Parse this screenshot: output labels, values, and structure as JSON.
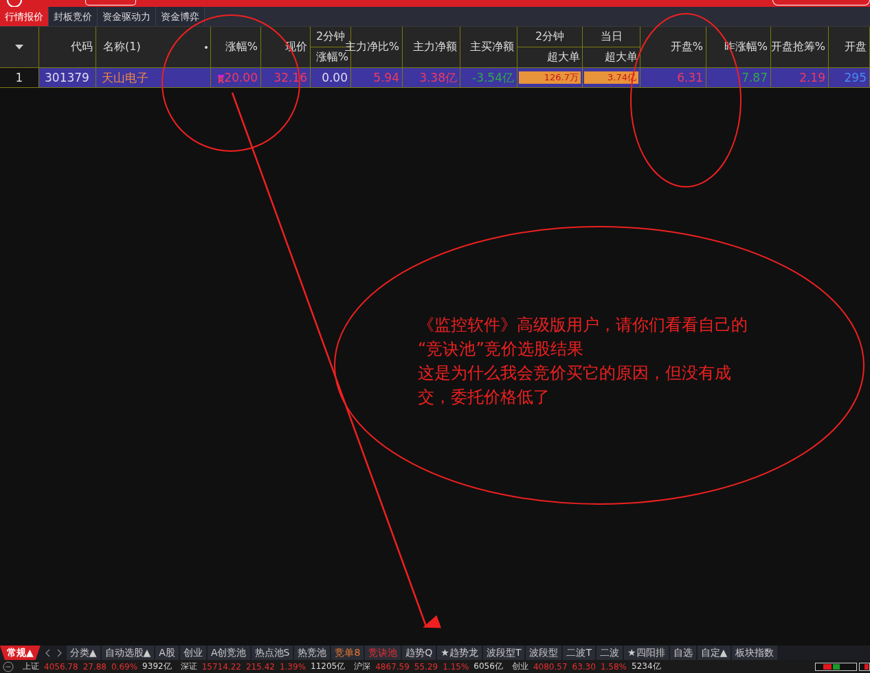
{
  "top_tabs": [
    {
      "label": "行情报价",
      "selected": true
    },
    {
      "label": "封板竞价",
      "selected": false
    },
    {
      "label": "资金驱动力",
      "selected": false
    },
    {
      "label": "资金博弈",
      "selected": false
    }
  ],
  "table": {
    "columns": [
      {
        "label": "代码"
      },
      {
        "label": "名称(1)"
      },
      {
        "label": "涨幅%"
      },
      {
        "label": "现价"
      },
      {
        "group": "2分钟",
        "label": "涨幅%"
      },
      {
        "label": "主力净比%"
      },
      {
        "label": "主力净额"
      },
      {
        "label": "主买净额"
      },
      {
        "group": "2分钟",
        "label": "超大单"
      },
      {
        "group": "当日",
        "label": "超大单"
      },
      {
        "label": "开盘%"
      },
      {
        "label": "昨涨幅%"
      },
      {
        "label": "开盘抢筹%"
      },
      {
        "label": "开盘"
      }
    ],
    "rows": [
      {
        "index": "1",
        "cells": [
          {
            "text": "301379",
            "kind": "plain"
          },
          {
            "text": "天山电子",
            "kind": "name"
          },
          {
            "text": "20.00",
            "kind": "up",
            "tag": "R"
          },
          {
            "text": "32.16",
            "kind": "up"
          },
          {
            "text": "0.00",
            "kind": "plain"
          },
          {
            "text": "5.94",
            "kind": "up"
          },
          {
            "text": "3.38亿",
            "kind": "up"
          },
          {
            "text": "-3.54亿",
            "kind": "down"
          },
          {
            "text": "126.7万",
            "kind": "bar"
          },
          {
            "text": "3.74亿",
            "kind": "bar"
          },
          {
            "text": "6.31",
            "kind": "up"
          },
          {
            "text": "7.87",
            "kind": "down"
          },
          {
            "text": "2.19",
            "kind": "up"
          },
          {
            "text": "295",
            "kind": "blue"
          }
        ]
      }
    ]
  },
  "annotation": {
    "lines": [
      "《监控软件》高级版用户，请你们看看自己的",
      "“竞诀池”竞价选股结果",
      "这是为什么我会竞价买它的原因，但没有成",
      "交，委托价格低了"
    ]
  },
  "bottom_tabs": [
    {
      "label": "常规▲",
      "kind": "primary",
      "selected": true
    },
    {
      "label": "分类▲",
      "kind": "normal",
      "selected": false
    },
    {
      "label": "自动选股▲",
      "kind": "normal",
      "selected": false
    },
    {
      "label": "A股",
      "kind": "normal",
      "selected": false
    },
    {
      "label": "创业",
      "kind": "normal",
      "selected": false
    },
    {
      "label": "A创竞池",
      "kind": "normal",
      "selected": false
    },
    {
      "label": "热点池S",
      "kind": "normal",
      "selected": false
    },
    {
      "label": "热竞池",
      "kind": "normal",
      "selected": false
    },
    {
      "label": "竞单8",
      "kind": "orange",
      "selected": false
    },
    {
      "label": "竞诀池",
      "kind": "normal",
      "selected": true
    },
    {
      "label": "趋势Q",
      "kind": "normal",
      "selected": false
    },
    {
      "label": "★趋势龙",
      "kind": "normal",
      "selected": false
    },
    {
      "label": "波段型T",
      "kind": "normal",
      "selected": false
    },
    {
      "label": "波段型",
      "kind": "normal",
      "selected": false
    },
    {
      "label": "二波T",
      "kind": "normal",
      "selected": false
    },
    {
      "label": "二波",
      "kind": "normal",
      "selected": false
    },
    {
      "label": "★四阳排",
      "kind": "normal",
      "selected": false
    },
    {
      "label": "自选",
      "kind": "normal",
      "selected": false
    },
    {
      "label": "自定▲",
      "kind": "normal",
      "selected": false
    },
    {
      "label": "板块指数",
      "kind": "normal",
      "selected": false
    }
  ],
  "status_bar": [
    {
      "text": "上证",
      "kind": "label"
    },
    {
      "text": "4056.78",
      "kind": "up"
    },
    {
      "text": "27.88",
      "kind": "up"
    },
    {
      "text": "0.69%",
      "kind": "up"
    },
    {
      "text": "9392亿",
      "kind": "plain"
    },
    {
      "text": "深证",
      "kind": "label"
    },
    {
      "text": "15714.22",
      "kind": "up"
    },
    {
      "text": "215.42",
      "kind": "up"
    },
    {
      "text": "1.39%",
      "kind": "up"
    },
    {
      "text": "11205亿",
      "kind": "plain"
    },
    {
      "text": "沪深",
      "kind": "label"
    },
    {
      "text": "4867.59",
      "kind": "up"
    },
    {
      "text": "55.29",
      "kind": "up"
    },
    {
      "text": "1.15%",
      "kind": "up"
    },
    {
      "text": "6056亿",
      "kind": "plain"
    },
    {
      "text": "创业",
      "kind": "label"
    },
    {
      "text": "4080.57",
      "kind": "up"
    },
    {
      "text": "63.30",
      "kind": "up"
    },
    {
      "text": "1.58%",
      "kind": "up"
    },
    {
      "text": "5234亿",
      "kind": "plain"
    }
  ]
}
